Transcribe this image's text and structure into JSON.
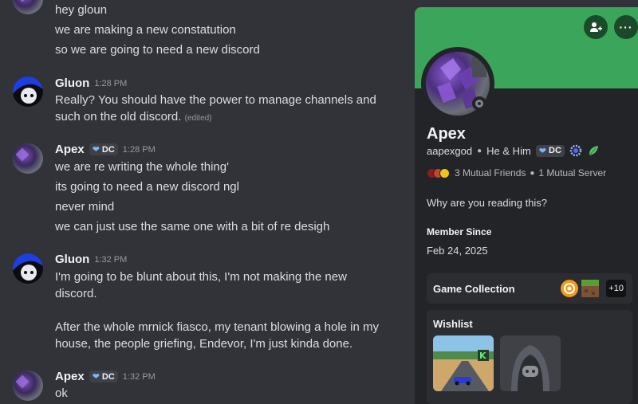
{
  "chat": {
    "messages_top": [
      {
        "text": "hey gloun"
      },
      {
        "text": "we are making a new constatution"
      },
      {
        "text": "so we are going to need a new discord"
      }
    ],
    "msg_gluon_1": {
      "username": "Gluon",
      "time": "1:28 PM",
      "lines": [
        "Really? You should have the power to manage channels and",
        "such on the old discord."
      ],
      "edited": "(edited)"
    },
    "msg_apex_1": {
      "username": "Apex",
      "tag": "DC",
      "time": "1:28 PM",
      "lines": [
        "we are re writing the whole thing'",
        "its going to need a new discord ngl",
        "never mind",
        "we can just use the same one with a bit of re desigh"
      ]
    },
    "msg_gluon_2": {
      "username": "Gluon",
      "time": "1:32 PM",
      "lines": [
        "I'm going to be blunt about this, I'm not making the new",
        "discord.",
        "After the whole mrnick fiasco, my tenant blowing a hole in my",
        "house, the people griefing, Endevor, I'm just kinda done."
      ]
    },
    "msg_apex_2": {
      "username": "Apex",
      "tag": "DC",
      "time": "1:32 PM",
      "lines": [
        "ok"
      ]
    }
  },
  "profile": {
    "display_name": "Apex",
    "username": "aapexgod",
    "pronouns": "He & Him",
    "tag": "DC",
    "mutual_friends": "3 Mutual Friends",
    "mutual_servers": "1 Mutual Server",
    "bio": "Why are you reading this?",
    "member_since_title": "Member Since",
    "member_since_date": "Feb 24, 2025",
    "game_collection_title": "Game Collection",
    "game_more": "+10",
    "wishlist_title": "Wishlist",
    "banner_color": "#3ba55c"
  }
}
